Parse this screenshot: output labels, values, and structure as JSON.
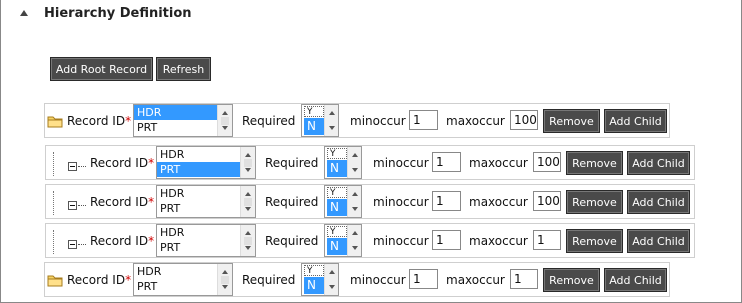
{
  "section": {
    "title": "Hierarchy Definition"
  },
  "toolbar": {
    "add_root_label": "Add Root Record",
    "refresh_label": "Refresh"
  },
  "labels": {
    "record_id": "Record ID",
    "required_star": "*",
    "required": "Required",
    "minoccur": "minoccur",
    "maxoccur": "maxoccur",
    "remove": "Remove",
    "add_child": "Add Child"
  },
  "rows": [
    {
      "kind": "root",
      "record_options": [
        "HDR",
        "PRT"
      ],
      "selected_record": "HDR",
      "required_options": [
        "Y",
        "N"
      ],
      "required_selected": "N",
      "minoccur": "1",
      "maxoccur": "100"
    },
    {
      "kind": "child",
      "record_options": [
        "HDR",
        "PRT"
      ],
      "selected_record": "PRT",
      "required_options": [
        "Y",
        "N"
      ],
      "required_selected": "N",
      "minoccur": "1",
      "maxoccur": "100"
    },
    {
      "kind": "child",
      "record_options": [
        "HDR",
        "PRT"
      ],
      "selected_record": "",
      "required_options": [
        "Y",
        "N"
      ],
      "required_selected": "N",
      "minoccur": "1",
      "maxoccur": "100"
    },
    {
      "kind": "child",
      "record_options": [
        "HDR",
        "PRT"
      ],
      "selected_record": "",
      "required_options": [
        "Y",
        "N"
      ],
      "required_selected": "N",
      "minoccur": "1",
      "maxoccur": "1"
    },
    {
      "kind": "root",
      "record_options": [
        "HDR",
        "PRT"
      ],
      "selected_record": "",
      "required_options": [
        "Y",
        "N"
      ],
      "required_selected": "N",
      "minoccur": "1",
      "maxoccur": "1"
    }
  ]
}
